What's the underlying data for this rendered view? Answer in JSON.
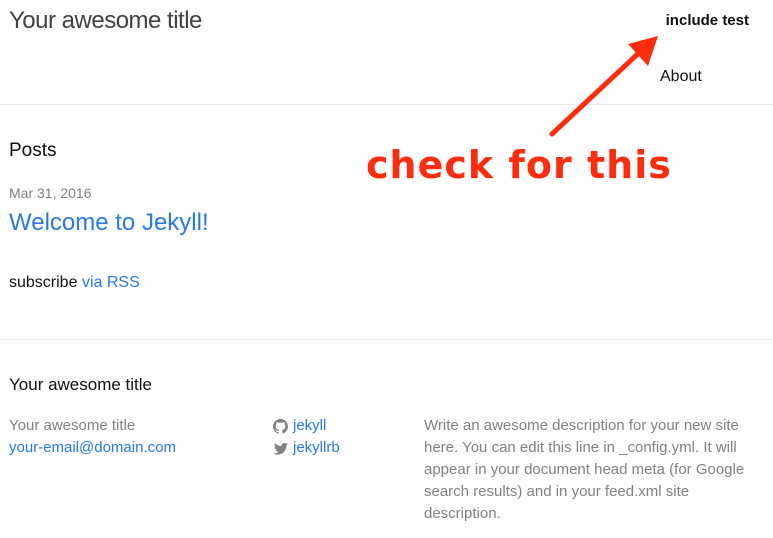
{
  "header": {
    "site_title": "Your awesome title",
    "nav": {
      "include_label": "include test",
      "about_label": "About"
    }
  },
  "annotation": {
    "text": "check for this",
    "color": "#fb2d0e"
  },
  "main": {
    "posts_heading": "Posts",
    "posts": [
      {
        "date": "Mar 31, 2016",
        "title": "Welcome to Jekyll!"
      }
    ],
    "subscribe_prefix": "subscribe",
    "subscribe_link": "via RSS"
  },
  "footer": {
    "heading": "Your awesome title",
    "site_name": "Your awesome title",
    "email": "your-email@domain.com",
    "social": [
      {
        "icon": "github-icon",
        "label": "jekyll"
      },
      {
        "icon": "twitter-icon",
        "label": "jekyllrb"
      }
    ],
    "description": "Write an awesome description for your new site here. You can edit this line in _config.yml. It will appear in your document head meta (for Google search results) and in your feed.xml site description."
  },
  "colors": {
    "link": "#2a7ae2",
    "muted_text": "#828282",
    "divider": "#e8e8e8",
    "background": "#fdfdfd"
  }
}
